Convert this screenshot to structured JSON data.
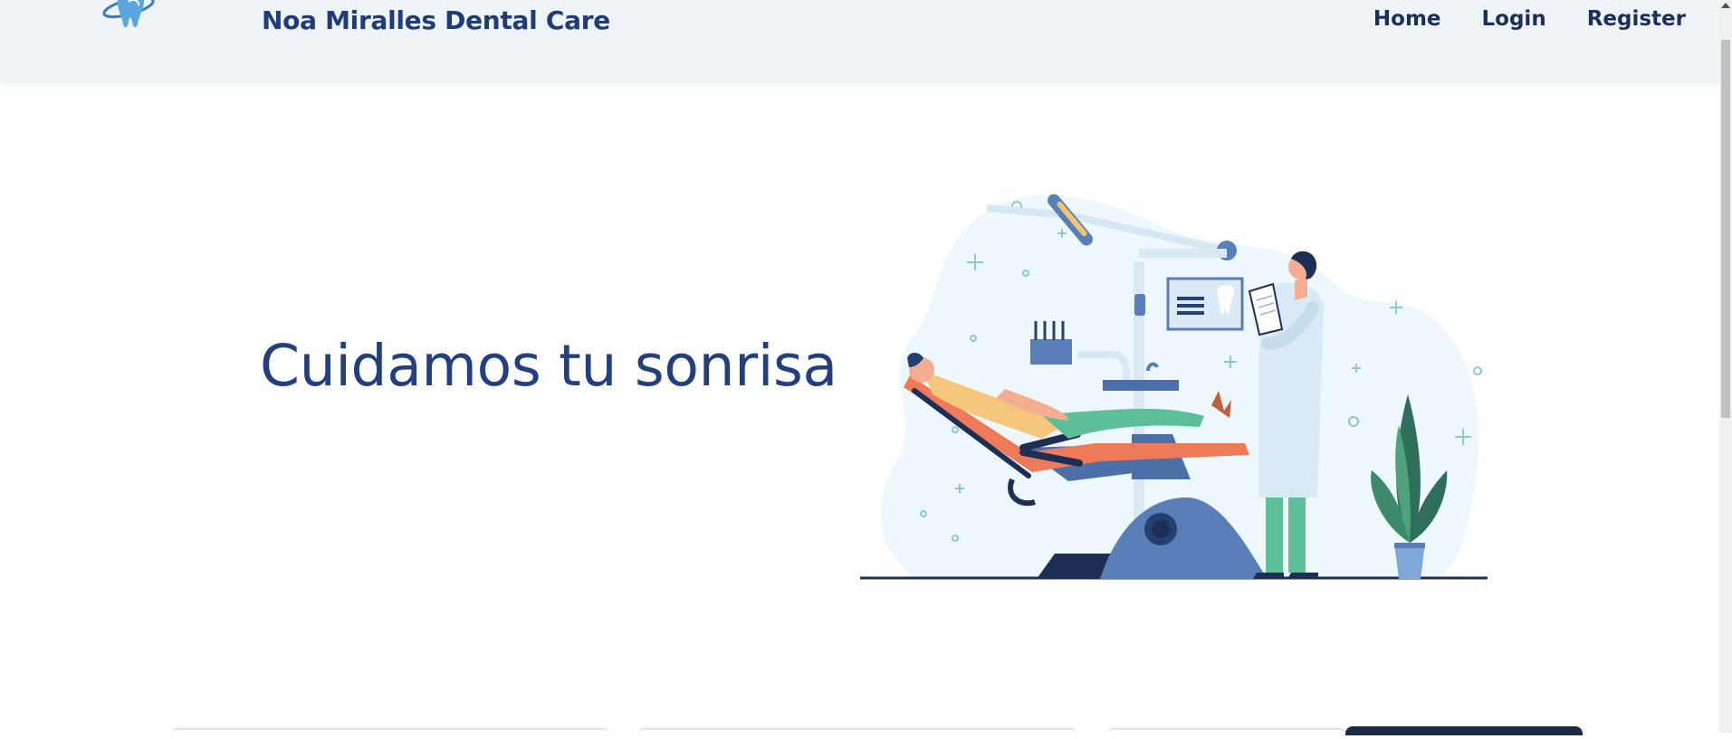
{
  "header": {
    "brand": "Noa Miralles Dental Care",
    "logo_icon": "tooth-logo-icon",
    "nav": [
      {
        "label": "Home"
      },
      {
        "label": "Login"
      },
      {
        "label": "Register"
      }
    ]
  },
  "hero": {
    "title": "Cuidamos tu sonrisa",
    "illustration_icon": "dentist-illustration"
  },
  "colors": {
    "brand_blue": "#1f3b78",
    "header_bg": "#eef3f6",
    "accent_orange": "#ef7a5a",
    "accent_green": "#5dbf9a"
  }
}
